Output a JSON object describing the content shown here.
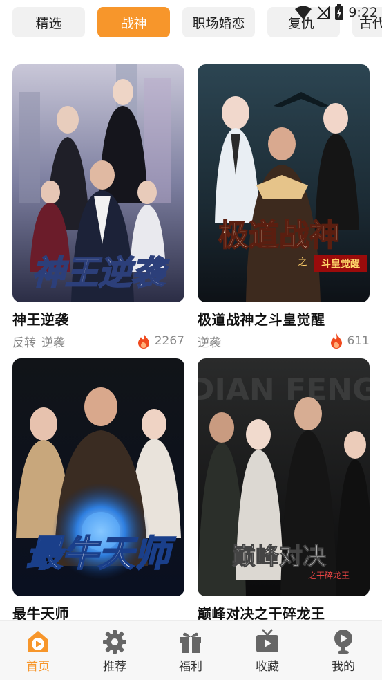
{
  "status_bar": {
    "time": "9:22"
  },
  "tabs": [
    {
      "label": "精选",
      "active": false
    },
    {
      "label": "战神",
      "active": true
    },
    {
      "label": "职场婚恋",
      "active": false
    },
    {
      "label": "复仇",
      "active": false
    },
    {
      "label": "古代",
      "active": false
    }
  ],
  "cards": [
    {
      "title": "神王逆袭",
      "poster_text": "神王逆袭",
      "tags": [
        "反转",
        "逆袭"
      ],
      "heat": "2267"
    },
    {
      "title": "极道战神之斗皇觉醒",
      "poster_text": "极道战神",
      "poster_sub": "之",
      "poster_tag": "斗皇觉醒",
      "tags": [
        "逆袭"
      ],
      "heat": "611"
    },
    {
      "title": "最牛天师",
      "poster_text": "最牛天师"
    },
    {
      "title": "巅峰对决之干碎龙王",
      "poster_text": "巅峰对决",
      "poster_sub": "之干碎龙王",
      "poster_top": "DIAN FENG"
    }
  ],
  "bottom_nav": [
    {
      "label": "首页",
      "icon": "home-play-icon",
      "active": true
    },
    {
      "label": "推荐",
      "icon": "gear-icon",
      "active": false
    },
    {
      "label": "福利",
      "icon": "gift-icon",
      "active": false
    },
    {
      "label": "收藏",
      "icon": "tv-icon",
      "active": false
    },
    {
      "label": "我的",
      "icon": "profile-icon",
      "active": false
    }
  ],
  "colors": {
    "accent": "#f7962b",
    "fire": "#f04a1e"
  }
}
